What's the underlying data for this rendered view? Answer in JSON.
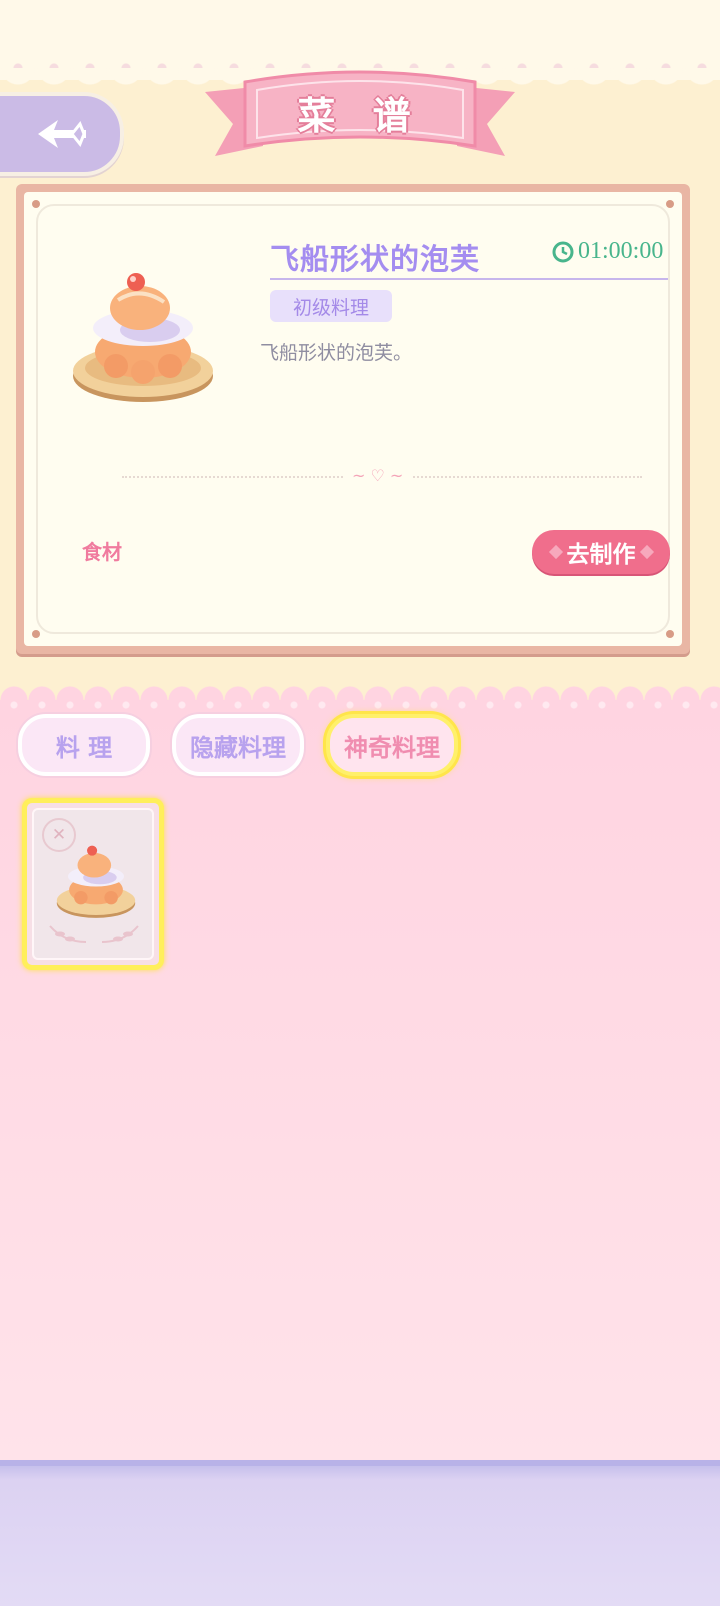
{
  "header": {
    "title": "菜 谱",
    "back_icon": "back-arrow-icon"
  },
  "recipe": {
    "name": "飞船形状的泡芙",
    "timer": "01:00:00",
    "level_badge": "初级料理",
    "description": "飞船形状的泡芙。",
    "ingredients_label": "食材",
    "make_button": "去制作"
  },
  "tabs": [
    {
      "label": "料 理",
      "selected": false
    },
    {
      "label": "隐藏料理",
      "selected": false
    },
    {
      "label": "神奇料理",
      "selected": true
    }
  ],
  "colors": {
    "accent_purple": "#a48df0",
    "accent_pink": "#f06e8c",
    "timer_green": "#48b58c",
    "selected_tab_border": "#ffe54a"
  }
}
